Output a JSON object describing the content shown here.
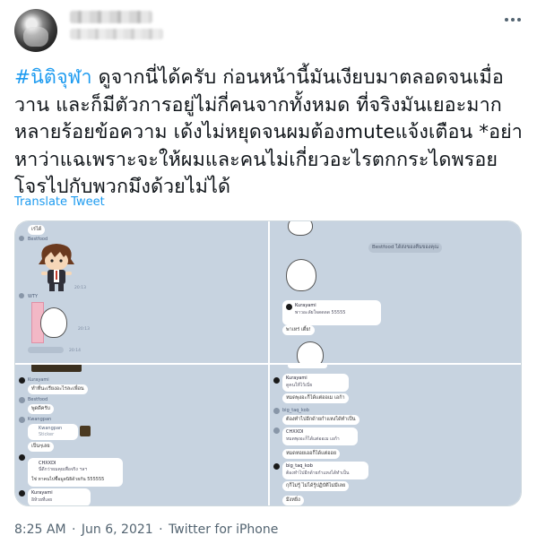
{
  "tweet": {
    "hashtag": "#นิติจุฬา",
    "text_lines": [
      " ดูจากนี่ได้ครับ ก่อนหน้านี้มันเงียบมาตลอดจนเมื่อ",
      "วาน และก็มีตัวการอยู่ไม่กี่คนจากทั้งหมด ที่จริงมันเยอะมาก",
      "หลายร้อยข้อความ เด้งไม่หยุดจนผมต้องmuteแจ้งเตือน *อย่า",
      "หาว่าแฉเพราะจะให้ผมและคนไม่เกี่ยวอะไรตกกระไดพรอย",
      "โจรไปกับพวกมึงด้วยไม่ได้"
    ],
    "translate_label": "Translate Tweet",
    "time": "8:25 AM",
    "date": "Jun 6, 2021",
    "source": "Twitter for iPhone",
    "separator": "·"
  },
  "icons": {
    "more": "more-horizontal-icon"
  },
  "colors": {
    "link": "#1d9bf0",
    "muted": "#536471",
    "chat_bg": "#c7d3e0"
  },
  "media": {
    "panel1": {
      "top_label": "เรได์",
      "user1": "Bestfood",
      "user2": "WTY",
      "time1": "20:13",
      "time2": "20:13",
      "time3": "20:14"
    },
    "panel2": {
      "system_msg": "Bestfood ได้ส่งของคืนของคุณ",
      "user": "Kurayami",
      "quote": "พาวอะลัยใจดดดด 55555",
      "reply": "พาเหร่ เตี้ย!"
    },
    "panel3": {
      "user1": "Kurayami",
      "msg1": "ทำที่นะเรียงอะไรละเพื่อน",
      "user2": "Bestfood",
      "msg2": "พูดดีครับ",
      "user3": "Kwangpan",
      "card_title": "Kwangpan",
      "card_sub": "Sticker",
      "msg3": "เป็นๆเลย",
      "user4": "CHXXDI",
      "card2_line": "นี่ดีกว่าผมคุยเพื่อจริง ฯลฯ",
      "msg4": "ใช่ หาคนไปซื้อมูลนิธิด้วยกัน 555555",
      "user5": "Kurayami",
      "msg5": "อิห้วยที่เลย"
    },
    "panel4": {
      "user1": "Kurayami",
      "msg1": "ดูคนให้ไว้เนี่ย",
      "msg2": "หมดพุงอะก็ได้แต่ออเม เอก้า",
      "user2": "big_taq_kob",
      "msg3": "ต้องทำไปอีกด้ายกำแหงได้ทำเป็น",
      "user3": "CHXXDI",
      "msg4": "หมดพุงอะก็ได้แต่ออเม เอก้า",
      "msg5": "หมดหอยเออก็ได้แต่ออย",
      "user4": "big_taq_kob",
      "msg6": "ต้องทำไปอีกด้ายกำแหงได้ทำเป็น",
      "msg7": "กุก็ไม่รู้ ไม่ได้รู้ปฏิบัติไม่มีเลย",
      "msg8": "มึงหยิ่ง"
    }
  }
}
